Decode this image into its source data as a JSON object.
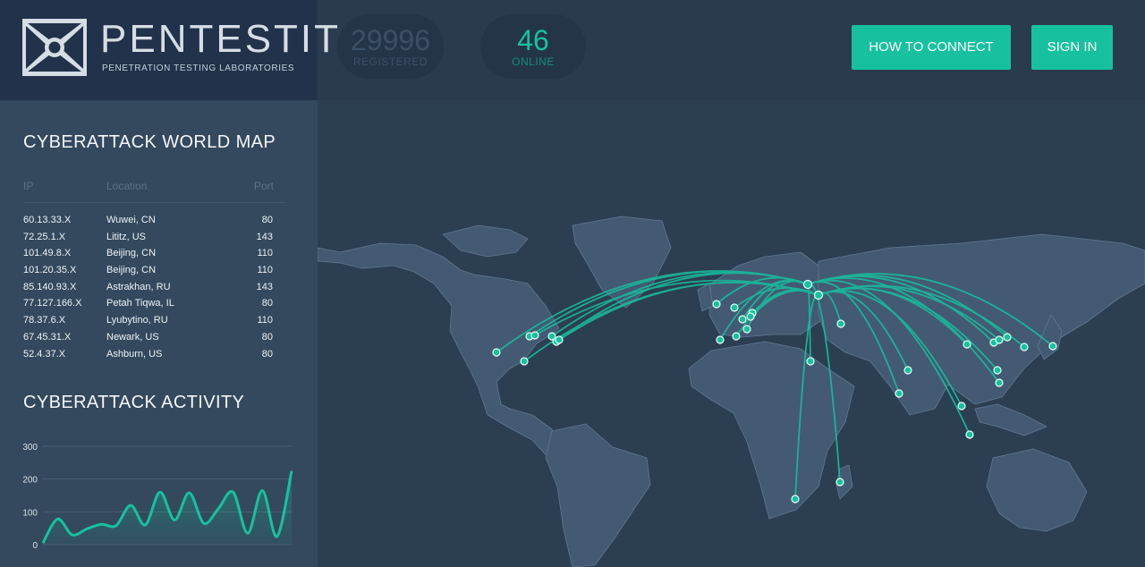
{
  "brand": {
    "title": "PENTESTIT",
    "subtitle": "PENETRATION TESTING LABORATORIES"
  },
  "stats": {
    "registered": {
      "value": "29996",
      "label": "REGISTERED"
    },
    "online": {
      "value": "46",
      "label": "ONLINE"
    }
  },
  "nav": {
    "how_to_connect": "HOW TO CONNECT",
    "sign_in": "SIGN IN"
  },
  "world_map": {
    "title": "CYBERATTACK WORLD MAP",
    "columns": [
      "IP",
      "Location",
      "Port"
    ],
    "rows": [
      [
        "60.13.33.X",
        "Wuwei, CN",
        "80"
      ],
      [
        "72.25.1.X",
        "Lititz, US",
        "143"
      ],
      [
        "101.49.8.X",
        "Beijing, CN",
        "110"
      ],
      [
        "101.20.35.X",
        "Beijing, CN",
        "110"
      ],
      [
        "85.140.93.X",
        "Astrakhan, RU",
        "143"
      ],
      [
        "77.127.166.X",
        "Petah Tiqwa, IL",
        "80"
      ],
      [
        "78.37.6.X",
        "Lyubytino, RU",
        "110"
      ],
      [
        "67.45.31.X",
        "Newark, US",
        "80"
      ],
      [
        "52.4.37.X",
        "Ashburn, US",
        "80"
      ]
    ]
  },
  "activity": {
    "title": "CYBERATTACK ACTIVITY"
  },
  "chart_data": {
    "type": "area",
    "title": "CYBERATTACK ACTIVITY",
    "ylim": [
      0,
      300
    ],
    "yticks": [
      "0",
      "100",
      "200",
      "300"
    ],
    "series": [
      {
        "values": [
          5,
          78,
          30,
          48,
          62,
          58,
          120,
          60,
          160,
          75,
          158,
          65,
          110,
          160,
          35,
          165,
          25,
          225
        ]
      }
    ]
  },
  "colors": {
    "accent": "#17c1a0",
    "background": "#2c3e52",
    "sidebar": "#34495e",
    "land": "#435a72"
  }
}
